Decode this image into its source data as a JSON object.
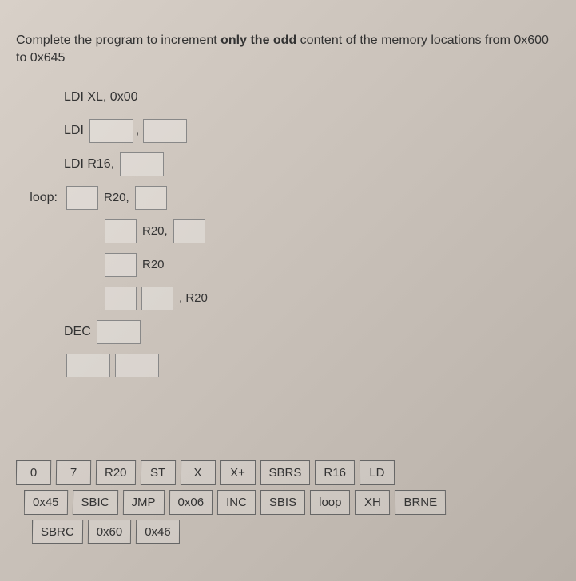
{
  "prompt": {
    "part1": "Complete the program to increment ",
    "bold": "only the odd",
    "part2": " content of the memory locations from 0x600 to 0x645"
  },
  "code": {
    "line1": "LDI XL, 0x00",
    "line2_label": "LDI",
    "line3_label": "LDI R16,",
    "loop_label": "loop:",
    "line4_mid": "R20,",
    "line5_mid": "R20,",
    "line6_mid": "R20",
    "line7_suffix": ", R20",
    "line8_label": "DEC"
  },
  "bank": {
    "row1": [
      "0",
      "7",
      "R20",
      "ST",
      "X",
      "X+",
      "SBRS",
      "R16",
      "LD"
    ],
    "row2": [
      "0x45",
      "SBIC",
      "JMP",
      "0x06",
      "INC",
      "SBIS",
      "loop",
      "XH",
      "BRNE"
    ],
    "row3": [
      "SBRC",
      "0x60",
      "0x46"
    ]
  }
}
